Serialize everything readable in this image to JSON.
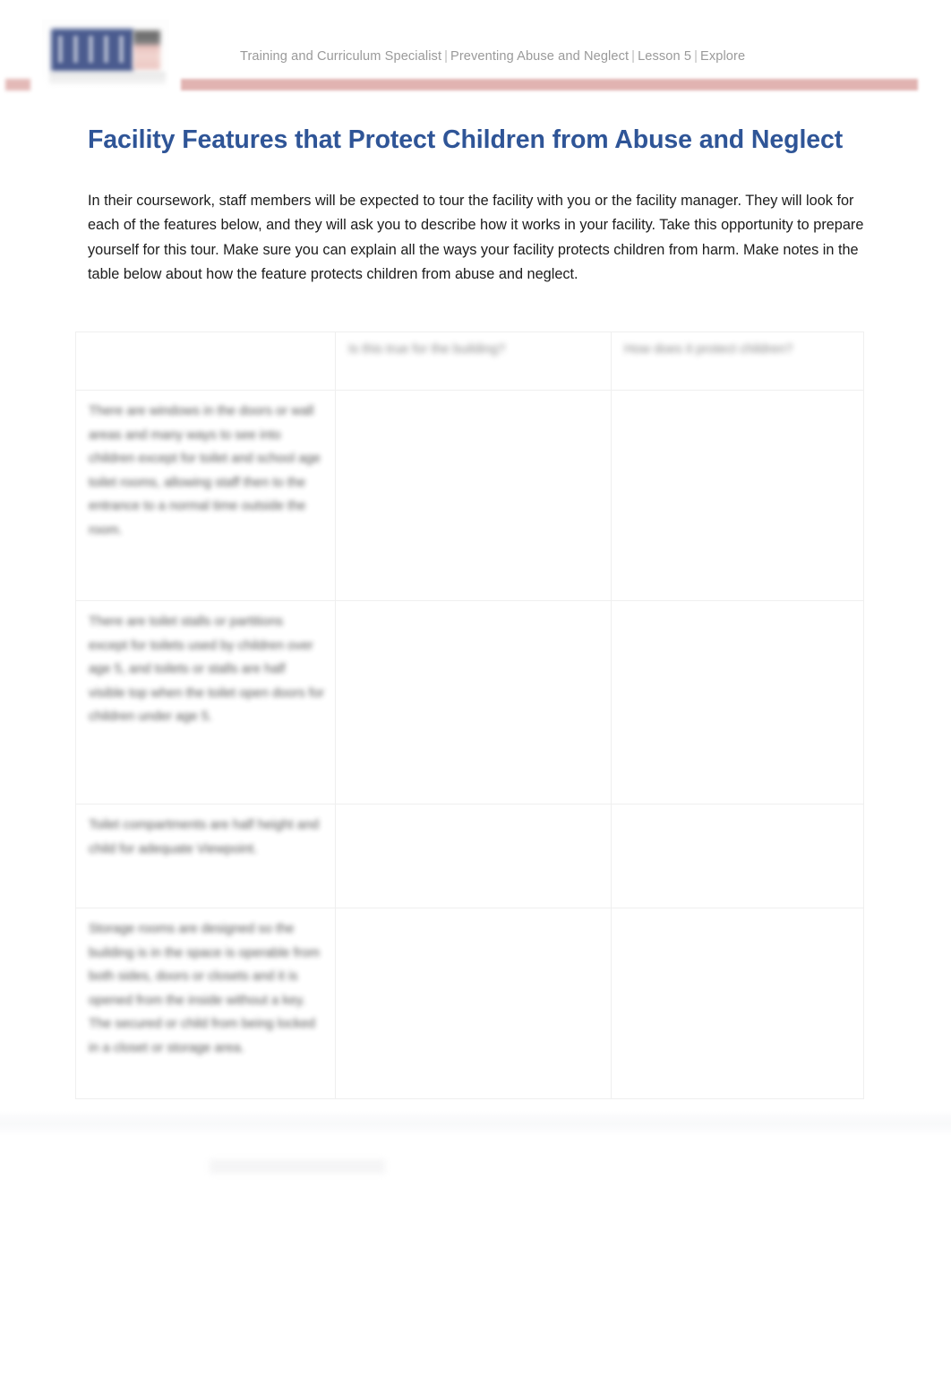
{
  "header": {
    "logo_alt": "organization-logo",
    "breadcrumb": {
      "items": [
        "Training and Curriculum Specialist",
        "Preventing Abuse and Neglect",
        "Lesson 5",
        "Explore"
      ],
      "separator": "|",
      "full_text": "Training and Curriculum Specialist  |  Preventing Abuse and Neglect  |  Lesson 5  |  Explore"
    },
    "accent_bar_color": "#dfadab"
  },
  "main": {
    "title": "Facility Features that Protect Children from Abuse and Neglect",
    "title_color": "#2f5597",
    "intro": "In their coursework, staff members will be expected to tour the facility with you or the facility manager. They will look for each of the features below, and they will ask you to describe how it works in your facility. Take this opportunity to prepare yourself for this tour. Make sure you can explain all the ways your facility protects children from harm. Make notes in the table below about how the feature protects children from abuse and neglect."
  },
  "table": {
    "headers": [
      "",
      "Is this true for the building?",
      "How does it protect children?"
    ],
    "rows": [
      {
        "feature": "There are windows in the doors or wall areas and many ways to see into children except for toilet and school age toilet rooms, allowing staff then to the entrance to a normal time outside the room.",
        "is_true": "",
        "protects": ""
      },
      {
        "feature": "There are toilet stalls or partitions except for toilets used by children over age 5, and toilets or stalls are half visible top when the toilet open doors for children under age 5.",
        "is_true": "",
        "protects": ""
      },
      {
        "feature": "Toilet compartments are half height and child for adequate Viewpoint.",
        "is_true": "",
        "protects": ""
      },
      {
        "feature": "Storage rooms are designed so the building is in the space is operable from both sides, doors or closets and it is opened from the inside without a key. The secured or child from being locked in a closet or storage area.",
        "is_true": "",
        "protects": ""
      }
    ]
  },
  "footer": {
    "ghost_label": ""
  }
}
